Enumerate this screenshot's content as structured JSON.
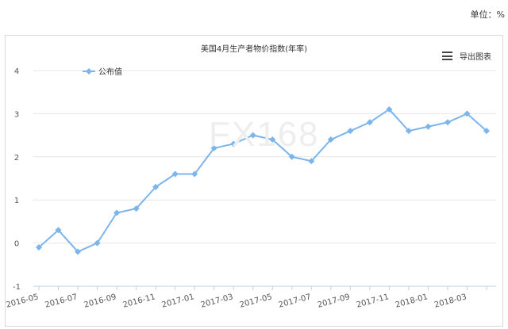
{
  "unit_label": "单位：%",
  "export_label": "导出图表",
  "watermark": "FX168",
  "chart_data": {
    "type": "line",
    "title": "美国4月生产者物价指数(年率)",
    "xlabel": "",
    "ylabel": "",
    "ylim": [
      -1,
      4
    ],
    "yticks": [
      -1,
      0,
      1,
      2,
      3,
      4
    ],
    "legend_position": "top-left",
    "grid": true,
    "x": [
      "2016-05",
      "2016-06",
      "2016-07",
      "2016-08",
      "2016-09",
      "2016-10",
      "2016-11",
      "2016-12",
      "2017-01",
      "2017-02",
      "2017-03",
      "2017-04",
      "2017-05",
      "2017-06",
      "2017-07",
      "2017-08",
      "2017-09",
      "2017-10",
      "2017-11",
      "2017-12",
      "2018-01",
      "2018-02",
      "2018-03",
      "2018-04"
    ],
    "x_tick_labels": [
      "2016-05",
      "2016-07",
      "2016-09",
      "2016-11",
      "2017-01",
      "2017-03",
      "2017-05",
      "2017-07",
      "2017-09",
      "2017-11",
      "2018-01",
      "2018-03"
    ],
    "series": [
      {
        "name": "公布值",
        "color": "#7cb5ec",
        "values": [
          -0.1,
          0.3,
          -0.2,
          0.0,
          0.7,
          0.8,
          1.3,
          1.6,
          1.6,
          2.2,
          2.3,
          2.5,
          2.4,
          2.0,
          1.9,
          2.4,
          2.6,
          2.8,
          3.1,
          2.6,
          2.7,
          2.8,
          3.0,
          2.6
        ]
      }
    ]
  }
}
